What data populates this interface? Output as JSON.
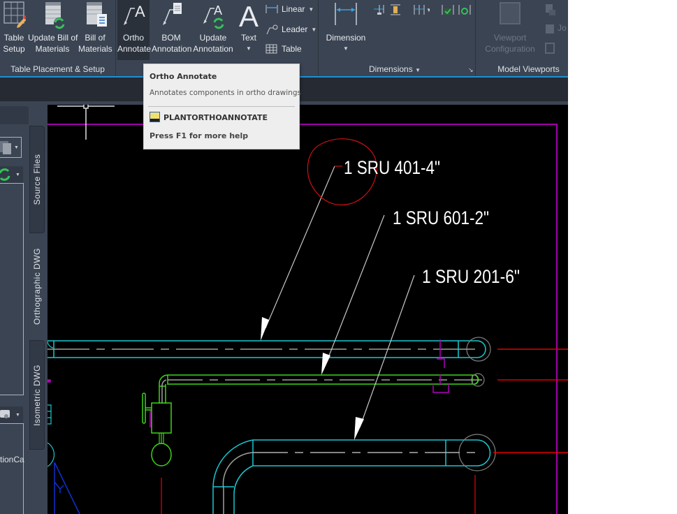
{
  "ribbon": {
    "panels": [
      {
        "title": "Table Placement & Setup"
      },
      {
        "title": ""
      },
      {
        "title": "Dimensions"
      },
      {
        "title": "Model Viewports"
      }
    ],
    "buttons": {
      "table_setup": [
        "Table",
        "Setup"
      ],
      "update_bom": [
        "Update Bill of",
        "Materials"
      ],
      "bill_of_materials": [
        "Bill of",
        "Materials"
      ],
      "ortho_annotate": [
        "Ortho",
        "Annotate"
      ],
      "bom_annotation": [
        "BOM",
        "Annotation"
      ],
      "update_annotation": [
        "Update",
        "Annotation"
      ],
      "text": [
        "Text"
      ],
      "linear": "Linear",
      "leader": "Leader",
      "table": "Table",
      "dimension": [
        "Dimension"
      ],
      "viewport_configuration": [
        "Viewport",
        "Configuration"
      ],
      "join": "Jo"
    }
  },
  "tooltip": {
    "title": "Ortho Annotate",
    "description": "Annotates components in ortho drawings",
    "command": "PLANTORTHOANNOTATE",
    "help": "Press F1 for more help"
  },
  "palette": {
    "tabs": [
      "Source Files",
      "Orthographic DWG",
      "Isometric DWG"
    ],
    "item_text": "tionCa"
  },
  "drawing": {
    "labels": [
      "1 SRU 401-4\"",
      "1 SRU 601-2\"",
      "1 SRU 201-6\""
    ],
    "colors": {
      "pipe_cyan": "#19c8d2",
      "pipe_green": "#3ed41a",
      "centerline": "#a0a0a0",
      "border_magenta": "#a000a8",
      "red": "#e00000",
      "markup_red": "#d01010",
      "blue": "#1030d0",
      "label": "#ffffff"
    }
  }
}
